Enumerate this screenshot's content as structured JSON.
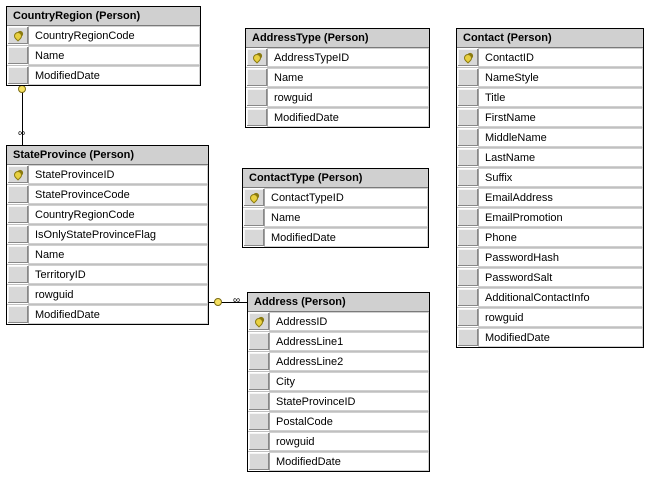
{
  "tables": {
    "countryRegion": {
      "title": "CountryRegion (Person)",
      "columns": [
        {
          "name": "CountryRegionCode",
          "pk": true
        },
        {
          "name": "Name",
          "pk": false
        },
        {
          "name": "ModifiedDate",
          "pk": false
        }
      ]
    },
    "addressType": {
      "title": "AddressType (Person)",
      "columns": [
        {
          "name": "AddressTypeID",
          "pk": true
        },
        {
          "name": "Name",
          "pk": false
        },
        {
          "name": "rowguid",
          "pk": false
        },
        {
          "name": "ModifiedDate",
          "pk": false
        }
      ]
    },
    "contact": {
      "title": "Contact (Person)",
      "columns": [
        {
          "name": "ContactID",
          "pk": true
        },
        {
          "name": "NameStyle",
          "pk": false
        },
        {
          "name": "Title",
          "pk": false
        },
        {
          "name": "FirstName",
          "pk": false
        },
        {
          "name": "MiddleName",
          "pk": false
        },
        {
          "name": "LastName",
          "pk": false
        },
        {
          "name": "Suffix",
          "pk": false
        },
        {
          "name": "EmailAddress",
          "pk": false
        },
        {
          "name": "EmailPromotion",
          "pk": false
        },
        {
          "name": "Phone",
          "pk": false
        },
        {
          "name": "PasswordHash",
          "pk": false
        },
        {
          "name": "PasswordSalt",
          "pk": false
        },
        {
          "name": "AdditionalContactInfo",
          "pk": false
        },
        {
          "name": "rowguid",
          "pk": false
        },
        {
          "name": "ModifiedDate",
          "pk": false
        }
      ]
    },
    "stateProvince": {
      "title": "StateProvince (Person)",
      "columns": [
        {
          "name": "StateProvinceID",
          "pk": true
        },
        {
          "name": "StateProvinceCode",
          "pk": false
        },
        {
          "name": "CountryRegionCode",
          "pk": false
        },
        {
          "name": "IsOnlyStateProvinceFlag",
          "pk": false
        },
        {
          "name": "Name",
          "pk": false
        },
        {
          "name": "TerritoryID",
          "pk": false
        },
        {
          "name": "rowguid",
          "pk": false
        },
        {
          "name": "ModifiedDate",
          "pk": false
        }
      ]
    },
    "contactType": {
      "title": "ContactType (Person)",
      "columns": [
        {
          "name": "ContactTypeID",
          "pk": true
        },
        {
          "name": "Name",
          "pk": false
        },
        {
          "name": "ModifiedDate",
          "pk": false
        }
      ]
    },
    "address": {
      "title": "Address (Person)",
      "columns": [
        {
          "name": "AddressID",
          "pk": true
        },
        {
          "name": "AddressLine1",
          "pk": false
        },
        {
          "name": "AddressLine2",
          "pk": false
        },
        {
          "name": "City",
          "pk": false
        },
        {
          "name": "StateProvinceID",
          "pk": false
        },
        {
          "name": "PostalCode",
          "pk": false
        },
        {
          "name": "rowguid",
          "pk": false
        },
        {
          "name": "ModifiedDate",
          "pk": false
        }
      ]
    }
  }
}
